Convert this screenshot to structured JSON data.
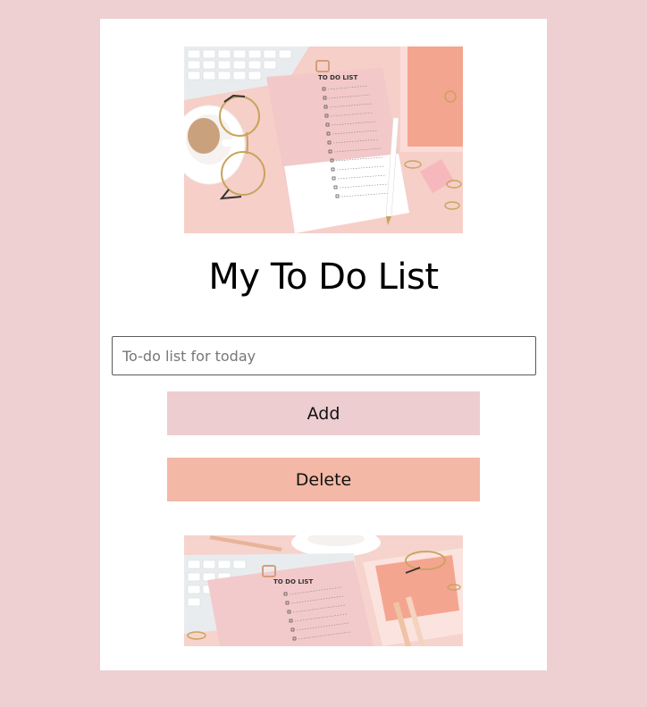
{
  "app": {
    "title": "My To Do List"
  },
  "input": {
    "placeholder": "To-do list for today",
    "value": ""
  },
  "buttons": {
    "add_label": "Add",
    "delete_label": "Delete"
  },
  "images": {
    "hero": "todo-list-desk-photo",
    "footer": "todo-list-keyboard-photo",
    "hero_title": "TO DO LIST",
    "hero_date": "03.",
    "footer_title": "TO DO LIST"
  },
  "colors": {
    "page_background": "#eed0d2",
    "card_background": "#ffffff",
    "add_button": "#eecdd0",
    "delete_button": "#f3b9a6"
  }
}
